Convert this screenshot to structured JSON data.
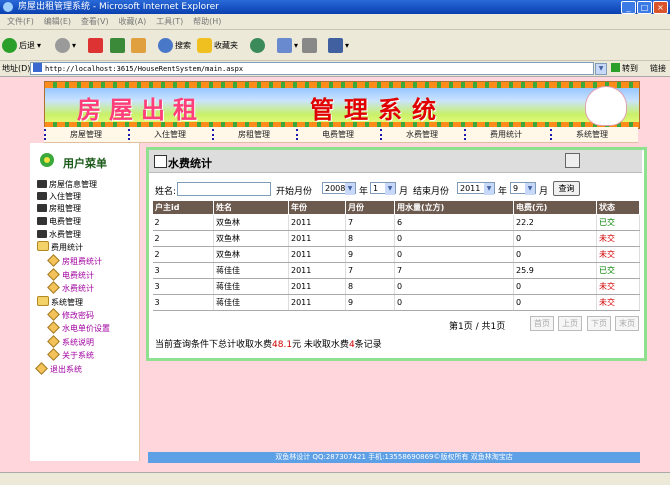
{
  "window": {
    "title": "房屋出租管理系统 - Microsoft Internet Explorer"
  },
  "menubar": {
    "items": [
      "文件(F)",
      "编辑(E)",
      "查看(V)",
      "收藏(A)",
      "工具(T)",
      "帮助(H)"
    ]
  },
  "toolbar": {
    "back": "后退",
    "search": "搜索",
    "favorites": "收藏夹"
  },
  "address": {
    "label": "地址(D)",
    "url": "http://localhost:3615/HouseRentSystem/main.aspx",
    "go": "转到",
    "links": "链接"
  },
  "banner": {
    "part1": "房屋出租",
    "part2": "管理系统"
  },
  "nav": {
    "items": [
      "房屋管理",
      "入住管理",
      "房租管理",
      "电费管理",
      "水费管理",
      "费用统计",
      "系统管理"
    ]
  },
  "leftmenu": {
    "title": "用户菜单",
    "items": [
      {
        "label": "房屋信息管理"
      },
      {
        "label": "入住管理"
      },
      {
        "label": "房租管理"
      },
      {
        "label": "电费管理"
      },
      {
        "label": "水费管理"
      },
      {
        "label": "费用统计"
      },
      {
        "label": "房租费统计"
      },
      {
        "label": "电费统计"
      },
      {
        "label": "水费统计"
      },
      {
        "label": "系统管理"
      },
      {
        "label": "修改密码"
      },
      {
        "label": "水电单价设置"
      },
      {
        "label": "系统说明"
      },
      {
        "label": "关于系统"
      },
      {
        "label": "退出系统"
      }
    ]
  },
  "panel": {
    "title": "水费统计"
  },
  "filter": {
    "name_label": "姓名",
    "name_value": "",
    "start_label": "开始月份",
    "start_year": "2008",
    "year_unit": "年",
    "start_month": "1",
    "month_unit": "月",
    "end_label": "结束月份",
    "end_year": "2011",
    "end_month": "9",
    "query": "查询"
  },
  "table": {
    "headers": [
      "户主id",
      "姓名",
      "年份",
      "月份",
      "用水量(立方)",
      "电费(元)",
      "状态"
    ],
    "rows": [
      [
        "2",
        "双鱼林",
        "2011",
        "7",
        "6",
        "22.2",
        "已交"
      ],
      [
        "2",
        "双鱼林",
        "2011",
        "8",
        "0",
        "0",
        "未交"
      ],
      [
        "2",
        "双鱼林",
        "2011",
        "9",
        "0",
        "0",
        "未交"
      ],
      [
        "3",
        "蒋佳佳",
        "2011",
        "7",
        "7",
        "25.9",
        "已交"
      ],
      [
        "3",
        "蒋佳佳",
        "2011",
        "8",
        "0",
        "0",
        "未交"
      ],
      [
        "3",
        "蒋佳佳",
        "2011",
        "9",
        "0",
        "0",
        "未交"
      ]
    ]
  },
  "pager": {
    "text": "第1页 / 共1页",
    "first": "首页",
    "prev": "上页",
    "next": "下页",
    "last": "末页"
  },
  "summary": {
    "prefix": "当前查询条件下总计收取水费",
    "amount": "48.1",
    "mid": "元  未收取水费",
    "count": "4",
    "suffix": "条记录"
  },
  "footer": {
    "text": "双鱼林设计 QQ:287307421 手机:13558690869©版权所有  双鱼林淘宝店"
  },
  "colors": {
    "menu_sub": "#a000a0",
    "paid": "#008000",
    "unpaid": "#d00000",
    "header_bg": "#6d5a4e",
    "panel_border": "#8fe08f"
  }
}
